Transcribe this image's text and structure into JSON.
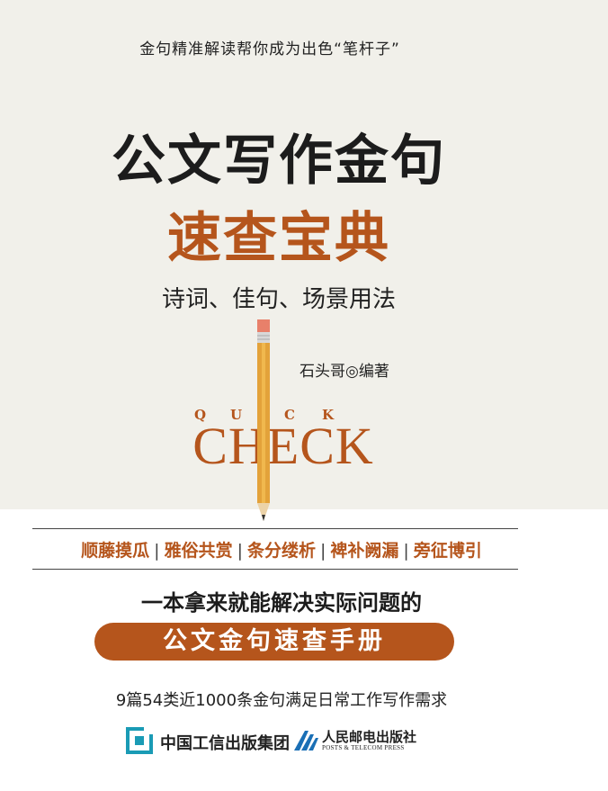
{
  "cover": {
    "tagline": "金句精准解读帮你成为出色“笔杆子”",
    "title_line1": "公文写作金句",
    "title_line2": "速查宝典",
    "subtitle": "诗词、佳句、场景用法",
    "author": "石头哥◎编著",
    "quick_letters": [
      "Q",
      "U",
      "C",
      "K"
    ],
    "check": "CHECK",
    "features": [
      "顺藤摸瓜",
      "雅俗共赏",
      "条分缕析",
      "裨补阙漏",
      "旁征博引"
    ],
    "feature_separator": "|",
    "slogan": "一本拿来就能解决实际问题的",
    "highlight": "公文金句速查手册",
    "description": "9篇54类近1000条金句满足日常工作写作需求"
  },
  "publishers": {
    "group_name": "中国工信出版集团",
    "press_name": "人民邮电出版社",
    "press_name_en": "POSTS & TELECOM PRESS"
  },
  "colors": {
    "accent": "#b5551c",
    "background_top": "#f1f0ea",
    "text": "#1c1c1c",
    "pencil": "#e3a23a",
    "eraser": "#e8806a"
  },
  "icons": {
    "pencil": "pencil-icon",
    "group_logo": "miit-group-logo-icon",
    "press_logo": "ptpress-logo-icon"
  }
}
